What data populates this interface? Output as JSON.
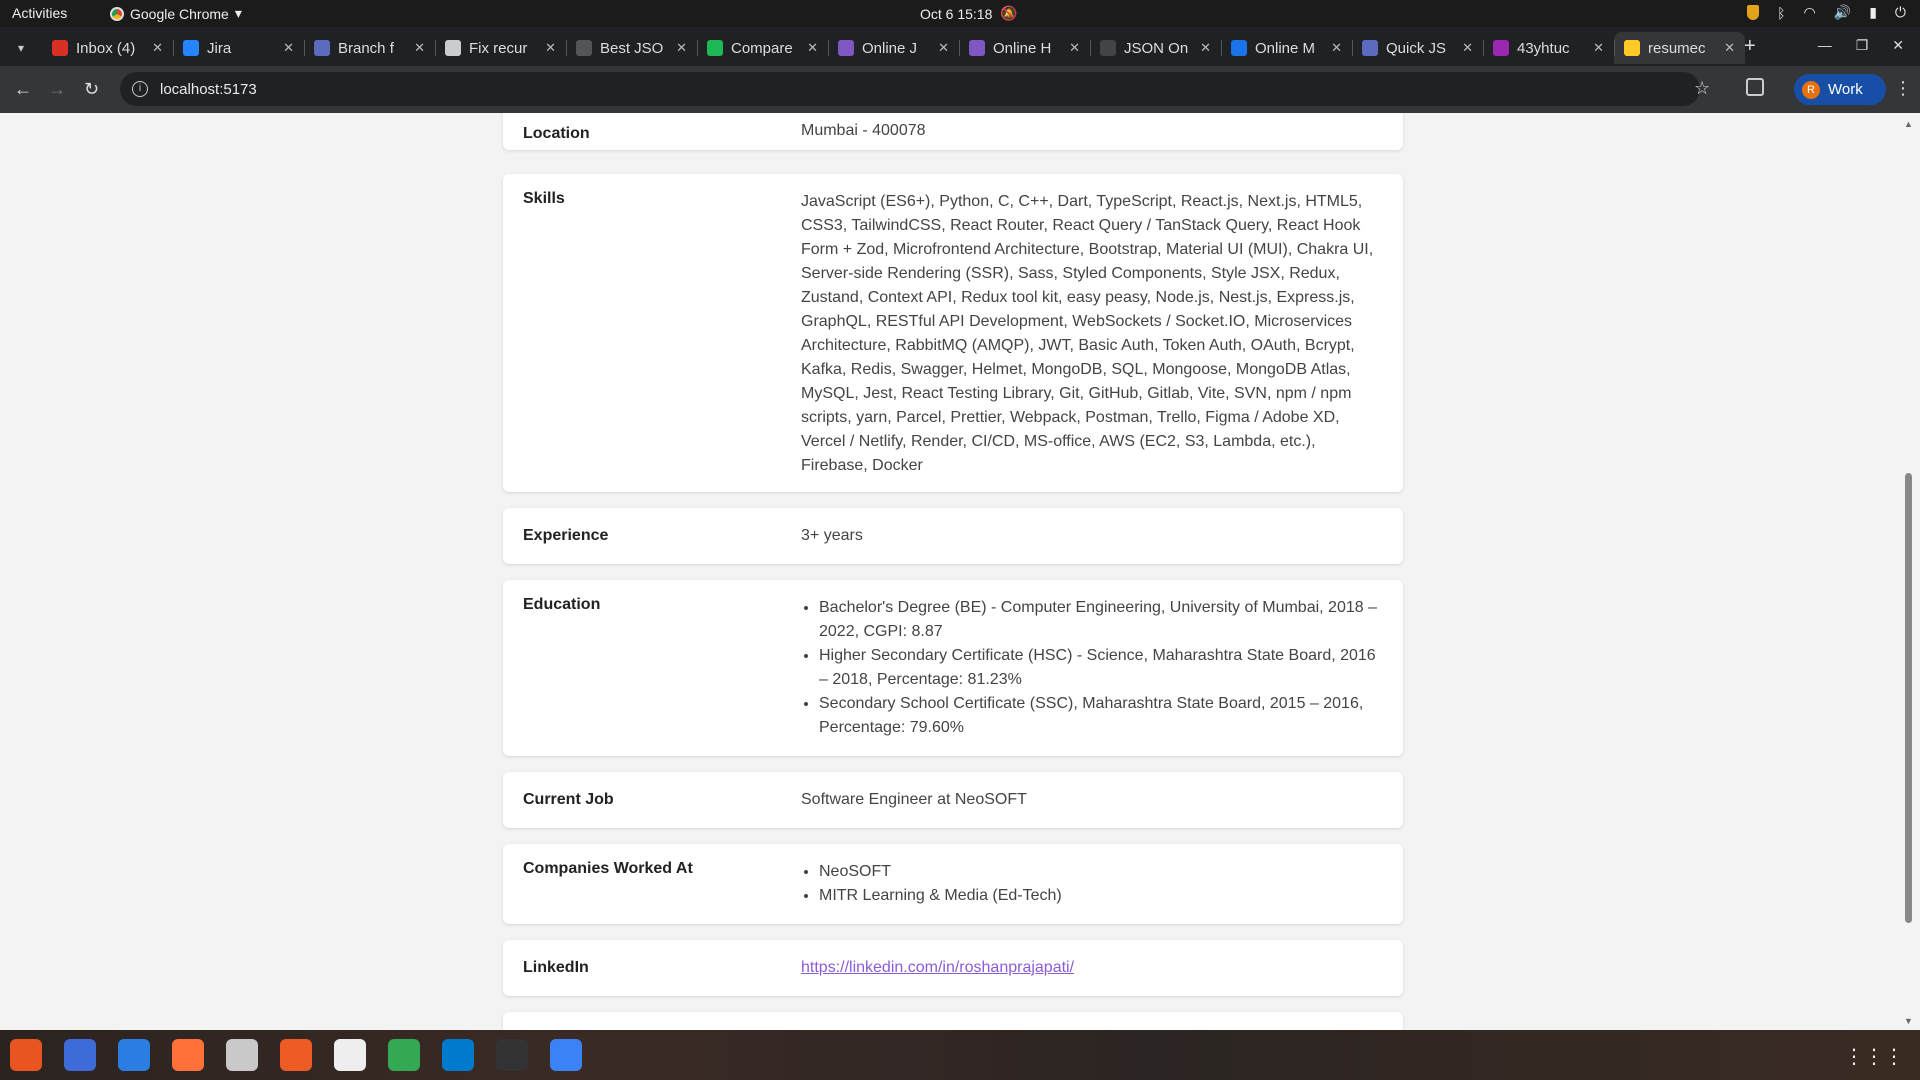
{
  "topbar": {
    "activities": "Activities",
    "app_name": "Google Chrome",
    "datetime": "Oct 6  15:18"
  },
  "tabs": [
    {
      "title": "Inbox (4)",
      "icon": "gmail-icon",
      "color": "#d93025"
    },
    {
      "title": "Jira",
      "icon": "jira-icon",
      "color": "#2684ff"
    },
    {
      "title": "Branch f",
      "icon": "bitbucket-icon",
      "color": "#5c6bc0"
    },
    {
      "title": "Fix recur",
      "icon": "openai-icon",
      "color": "#cccccc"
    },
    {
      "title": "Best JSO",
      "icon": "jsonformatter-icon",
      "color": "#555555"
    },
    {
      "title": "Compare",
      "icon": "diff-icon",
      "color": "#1db954"
    },
    {
      "title": "Online J",
      "icon": "online-json-icon",
      "color": "#7e57c2"
    },
    {
      "title": "Online H",
      "icon": "online-html-icon",
      "color": "#7e57c2"
    },
    {
      "title": "JSON On",
      "icon": "json-online-icon",
      "color": "#444444"
    },
    {
      "title": "Online M",
      "icon": "online-m-icon",
      "color": "#1a73e8"
    },
    {
      "title": "Quick JS",
      "icon": "quicktype-icon",
      "color": "#5c6bc0"
    },
    {
      "title": "43yhtuc",
      "icon": "code-icon",
      "color": "#9c27b0"
    },
    {
      "title": "resumec",
      "icon": "vite-icon",
      "color": "#ffca28",
      "active": true
    }
  ],
  "toolbar": {
    "url": "localhost:5173",
    "profile_label": "Work",
    "profile_initial": "R"
  },
  "resume": {
    "location": {
      "label": "Location",
      "value": "Mumbai - 400078"
    },
    "skills": {
      "label": "Skills",
      "value": "JavaScript (ES6+), Python, C, C++, Dart, TypeScript, React.js, Next.js, HTML5, CSS3, TailwindCSS, React Router, React Query / TanStack Query, React Hook Form + Zod, Microfrontend Architecture, Bootstrap, Material UI (MUI), Chakra UI, Server-side Rendering (SSR), Sass, Styled Components, Style JSX, Redux, Zustand, Context API, Redux tool kit, easy peasy, Node.js, Nest.js, Express.js, GraphQL, RESTful API Development, WebSockets / Socket.IO, Microservices Architecture, RabbitMQ (AMQP), JWT, Basic Auth, Token Auth, OAuth, Bcrypt, Kafka, Redis, Swagger, Helmet, MongoDB, SQL, Mongoose, MongoDB Atlas, MySQL, Jest, React Testing Library, Git, GitHub, Gitlab, Vite, SVN, npm / npm scripts, yarn, Parcel, Prettier, Webpack, Postman, Trello, Figma / Adobe XD, Vercel / Netlify, Render, CI/CD, MS-office, AWS (EC2, S3, Lambda, etc.), Firebase, Docker"
    },
    "experience": {
      "label": "Experience",
      "value": "3+ years"
    },
    "education": {
      "label": "Education",
      "items": [
        "Bachelor's Degree (BE) - Computer Engineering, University of Mumbai, 2018 – 2022, CGPI: 8.87",
        "Higher Secondary Certificate (HSC) - Science, Maharashtra State Board, 2016 – 2018, Percentage: 81.23%",
        "Secondary School Certificate (SSC), Maharashtra State Board, 2015 – 2016, Percentage: 79.60%"
      ]
    },
    "current_job": {
      "label": "Current Job",
      "value": "Software Engineer at NeoSOFT"
    },
    "companies": {
      "label": "Companies Worked At",
      "items": [
        "NeoSOFT",
        "MITR Learning & Media (Ed-Tech)"
      ]
    },
    "linkedin": {
      "label": "LinkedIn",
      "value": "https://linkedin.com/in/roshanprajapati/"
    }
  },
  "dock": [
    {
      "icon": "app-center-icon",
      "color": "#e95420"
    },
    {
      "icon": "brave-icon",
      "color": "#3f6bd8"
    },
    {
      "icon": "thunderbird-icon",
      "color": "#2a7de1"
    },
    {
      "icon": "firefox-icon",
      "color": "#ff7139"
    },
    {
      "icon": "files-icon",
      "color": "#c9c9c9"
    },
    {
      "icon": "postman-icon",
      "color": "#ef5b25"
    },
    {
      "icon": "ublock-icon",
      "color": "#eeeeee"
    },
    {
      "icon": "chrome-icon",
      "color": "#34a853"
    },
    {
      "icon": "vscode-icon",
      "color": "#007acc"
    },
    {
      "icon": "terminal-icon",
      "color": "#333333"
    },
    {
      "icon": "text-editor-icon",
      "color": "#3b82f6"
    }
  ]
}
